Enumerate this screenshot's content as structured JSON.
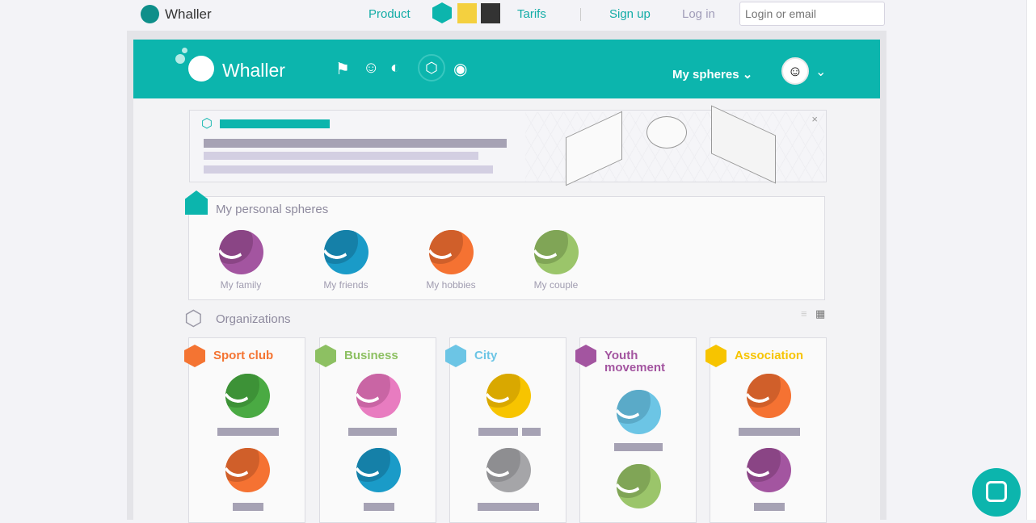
{
  "topbar": {
    "brand": "Whaller",
    "product": "Product",
    "tarifs": "Tarifs",
    "signup": "Sign up",
    "login": "Log in",
    "login_placeholder": "Login or email"
  },
  "header": {
    "brand": "Whaller",
    "my_spheres": "My spheres",
    "icons": [
      "flag-icon",
      "add-user-icon",
      "add-sphere-icon",
      "add-organization-icon",
      "search-icon"
    ]
  },
  "personal": {
    "title": "My personal spheres",
    "spheres": [
      {
        "label": "My family",
        "color": "#a355a0",
        "dark": "#8a4585"
      },
      {
        "label": "My friends",
        "color": "#1a9bc8",
        "dark": "#1580a8"
      },
      {
        "label": "My hobbies",
        "color": "#f57232",
        "dark": "#d05f2a"
      },
      {
        "label": "My couple",
        "color": "#9bc56a",
        "dark": "#80a556"
      }
    ]
  },
  "organizations": {
    "title": "Organizations",
    "items": [
      {
        "name": "Sport club",
        "color": "#f47432",
        "spheres": [
          {
            "color": "#4aaa43",
            "dark": "#3d9237"
          },
          {
            "color": "#f57232",
            "dark": "#d05f2a"
          }
        ]
      },
      {
        "name": "Business",
        "color": "#8dc062",
        "spheres": [
          {
            "color": "#e87cc0",
            "dark": "#c965a4"
          },
          {
            "color": "#1a9bc8",
            "dark": "#1580a8"
          }
        ]
      },
      {
        "name": "City",
        "color": "#6cc5e5",
        "spheres": [
          {
            "color": "#f7c400",
            "dark": "#d9a800"
          },
          {
            "color": "#a5a5a8",
            "dark": "#8e8e91"
          }
        ]
      },
      {
        "name": "Youth movement",
        "color": "#a355a0",
        "spheres": [
          {
            "color": "#6cc5e5",
            "dark": "#5aaac8"
          },
          {
            "color": "#9bc56a",
            "dark": "#80a556"
          }
        ]
      },
      {
        "name": "Association",
        "color": "#f7c400",
        "spheres": [
          {
            "color": "#f57232",
            "dark": "#d05f2a"
          },
          {
            "color": "#a355a0",
            "dark": "#8a4585"
          }
        ]
      }
    ]
  },
  "colors": {
    "teal": "#0cb5ad"
  }
}
